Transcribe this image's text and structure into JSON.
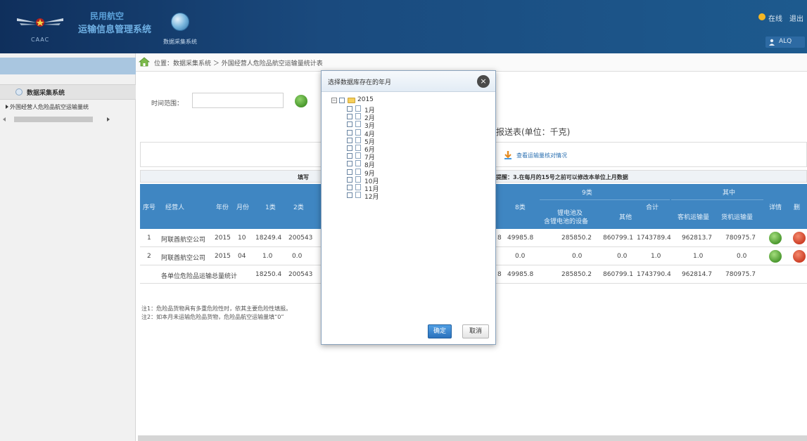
{
  "header": {
    "logo_text": "CAAC",
    "system_title_line1": "民用航空",
    "system_title_line2": "运输信息管理系统",
    "module_name": "数据采集系统",
    "online_label": "在线",
    "logout_label": "退出",
    "user_name": "ALQ"
  },
  "sidebar": {
    "menu_head": "数据采集系统",
    "items": [
      {
        "label": "外国经营人危险品航空运输量统"
      }
    ]
  },
  "main": {
    "breadcrumb": "位置：数据采集系统 ＞ 外国经营人危险品航空运输量统计表",
    "time_label": "时间范围：",
    "time_value": "",
    "report_title_tail": "报送表(单位：千克)",
    "import_link": "查看运输量核对情况",
    "notice_left": "填写",
    "notice_right": "提醒：3.在每月的15号之前可以修改本单位上月数据"
  },
  "table": {
    "headers": {
      "seq": "序号",
      "operator": "经营人",
      "year": "年份",
      "month": "月份",
      "class1": "1类",
      "class2": "2类",
      "class8": "8类",
      "class9": "9类",
      "class9_sub1_line1": "锂电池及",
      "class9_sub1_line2": "含锂电池的设备",
      "class9_sub2": "其他",
      "total": "合计",
      "of_which": "其中",
      "passenger": "客机运输量",
      "cargo": "货机运输量",
      "detail": "详情",
      "delete": "删"
    },
    "rows": [
      {
        "seq": "1",
        "operator": "阿联酋航空公司",
        "year": "2015",
        "month": "10",
        "class1": "18249.4",
        "class2": "200543",
        "partial": "8",
        "class8": "49985.8",
        "lithium": "285850.2",
        "other": "860799.1",
        "total": "1743789.4",
        "passenger": "962813.7",
        "cargo": "780975.7"
      },
      {
        "seq": "2",
        "operator": "阿联酋航空公司",
        "year": "2015",
        "month": "04",
        "class1": "1.0",
        "class2": "0.0",
        "partial": "",
        "class8": "0.0",
        "lithium": "0.0",
        "other": "0.0",
        "total": "1.0",
        "passenger": "1.0",
        "cargo": "0.0"
      }
    ],
    "summary": {
      "label": "各单位危险品运输总量统计",
      "class1": "18250.4",
      "class2": "200543",
      "partial": "8",
      "class8": "49985.8",
      "lithium": "285850.2",
      "other": "860799.1",
      "total": "1743790.4",
      "passenger": "962814.7",
      "cargo": "780975.7"
    }
  },
  "notes": [
    "注1：危险品货物具有多重危险性时，依其主要危险性填报。",
    "注2：如本月未运输危险品货物，危险品航空运输量填“0”"
  ],
  "modal": {
    "title": "选择数据库存在的年月",
    "close_symbol": "×",
    "tree": {
      "year": "2015",
      "months": [
        "1月",
        "2月",
        "3月",
        "4月",
        "5月",
        "6月",
        "7月",
        "8月",
        "9月",
        "10月",
        "11月",
        "12月"
      ]
    },
    "ok_label": "确定",
    "cancel_label": "取消"
  },
  "colors": {
    "header_bg": "#1a4a7e",
    "table_header": "#3f86c2",
    "primary_button": "#2b72bd"
  }
}
